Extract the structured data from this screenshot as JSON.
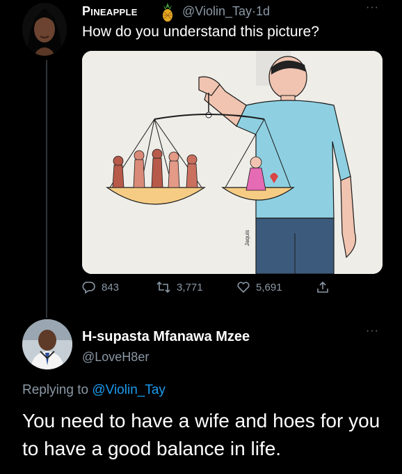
{
  "tweet": {
    "author_name": "Pineapple",
    "author_handle": "@Violin_Tay",
    "separator": "·",
    "time": "1d",
    "text": "How do you understand this picture?",
    "image_signature": "Jaquis",
    "actions": {
      "replies": "843",
      "retweets": "3,771",
      "likes": "5,691"
    },
    "more_label": "···"
  },
  "reply": {
    "author_name": "H-supasta Mfanawa Mzee",
    "author_handle": "@LoveH8er",
    "replying_prefix": "Replying to",
    "replying_to": "@Violin_Tay",
    "text": "You need to have a wife and hoes for you to have a good balance in life.",
    "more_label": "···"
  },
  "colors": {
    "background": "#000000",
    "primary_text": "#ffffff",
    "secondary_text": "#8b98a5",
    "mention": "#1d9bf0",
    "divider": "#2f3336"
  },
  "icons": [
    "pineapple-emoji-icon",
    "reply-icon",
    "retweet-icon",
    "like-icon",
    "share-icon",
    "more-icon"
  ]
}
